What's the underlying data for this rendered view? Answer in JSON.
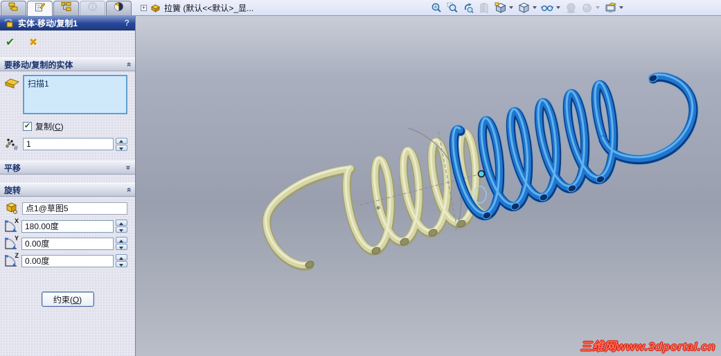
{
  "top_bar": {
    "expand_glyph": "+",
    "feature_tree_root": "拉簧 (默认<<默认>_显..."
  },
  "pm_tabs": [
    "featuremanager",
    "propertymanager",
    "configurationmanager",
    "dimxpertmanager",
    "displaymanager"
  ],
  "headsup_toolbar": {
    "tools": [
      "zoom-to-fit",
      "zoom-to-area",
      "previous-view",
      "section-view",
      "view-orientation",
      "display-style",
      "hide-show-items",
      "shadows",
      "appearance",
      "scene"
    ]
  },
  "property_manager": {
    "title": "实体-移动/复制1",
    "help_label": "?",
    "bodies_section": {
      "header": "要移动/复制的实体",
      "list_items": [
        "扫描1"
      ],
      "copy_label_pre": "复制(",
      "copy_label_key": "C",
      "copy_label_post": ")",
      "copy_checked": "✔",
      "copies_value": "1"
    },
    "translate_section": {
      "header": "平移"
    },
    "rotate_section": {
      "header": "旋转",
      "origin_value": "点1@草图5",
      "rows": [
        {
          "axis": "X",
          "value": "180.00度"
        },
        {
          "axis": "Y",
          "value": "0.00度"
        },
        {
          "axis": "Z",
          "value": "0.00度"
        }
      ]
    },
    "ok_glyph": "✔",
    "cancel_glyph": "✖",
    "constrain_pre": "约束(",
    "constrain_key": "O",
    "constrain_post": ")"
  },
  "viewport": {
    "watermark": "三维网www.3dportal.cn"
  },
  "scene": {
    "body_spring": {
      "main": "#d6d6a6",
      "dark": "#9f9f73",
      "light": "#efefd2",
      "tip": "#8f8f63",
      "tip_edge": "#70704e"
    },
    "copy_spring": {
      "main": "#1e78d2",
      "dark": "#0d3a7e",
      "light": "#6ab8f0",
      "tip": "#0a2f66",
      "tip_edge": "#5ab0ff",
      "halo": "#5ca8e8"
    },
    "sketch_color": "#878c98",
    "selection_point_color": "#55ccff"
  }
}
